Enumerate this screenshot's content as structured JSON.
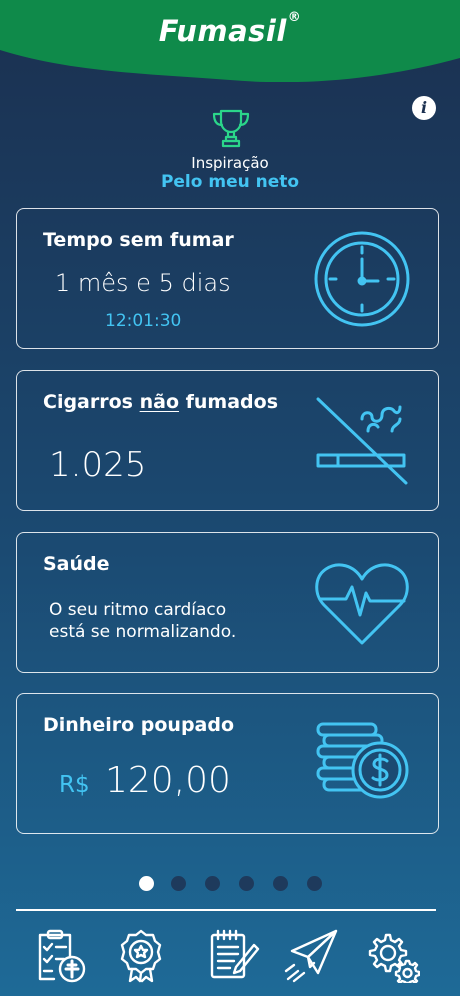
{
  "app": {
    "brand": "Fumasil",
    "brand_mark": "®",
    "info_label": "i"
  },
  "inspiration": {
    "label": "Inspiração",
    "value": "Pelo meu neto",
    "icon": "trophy-icon"
  },
  "cards": {
    "time": {
      "title": "Tempo sem fumar",
      "value": "1 mês e 5 dias",
      "timer": "12:01:30",
      "icon": "clock-icon"
    },
    "cigarettes": {
      "title_prefix": "Cigarros ",
      "title_emphasis": "não",
      "title_suffix": " fumados",
      "value": "1.025",
      "icon": "no-smoking-icon"
    },
    "health": {
      "title": "Saúde",
      "line1": "O seu ritmo cardíaco",
      "line2": "está se normalizando.",
      "icon": "heart-pulse-icon"
    },
    "money": {
      "title": "Dinheiro poupado",
      "currency": "R$",
      "value": "120,00",
      "icon": "coins-icon"
    }
  },
  "pagination": {
    "total": 6,
    "active": 0
  },
  "bottom_nav": [
    {
      "name": "checklist-health-icon"
    },
    {
      "name": "award-badge-icon"
    },
    {
      "name": "notepad-icon"
    },
    {
      "name": "paper-plane-icon"
    },
    {
      "name": "settings-gears-icon"
    }
  ],
  "colors": {
    "brand_green": "#0f8a4a",
    "accent_cyan": "#43c4f2",
    "background_top": "#1b3050",
    "background_bottom": "#1e6a97"
  }
}
